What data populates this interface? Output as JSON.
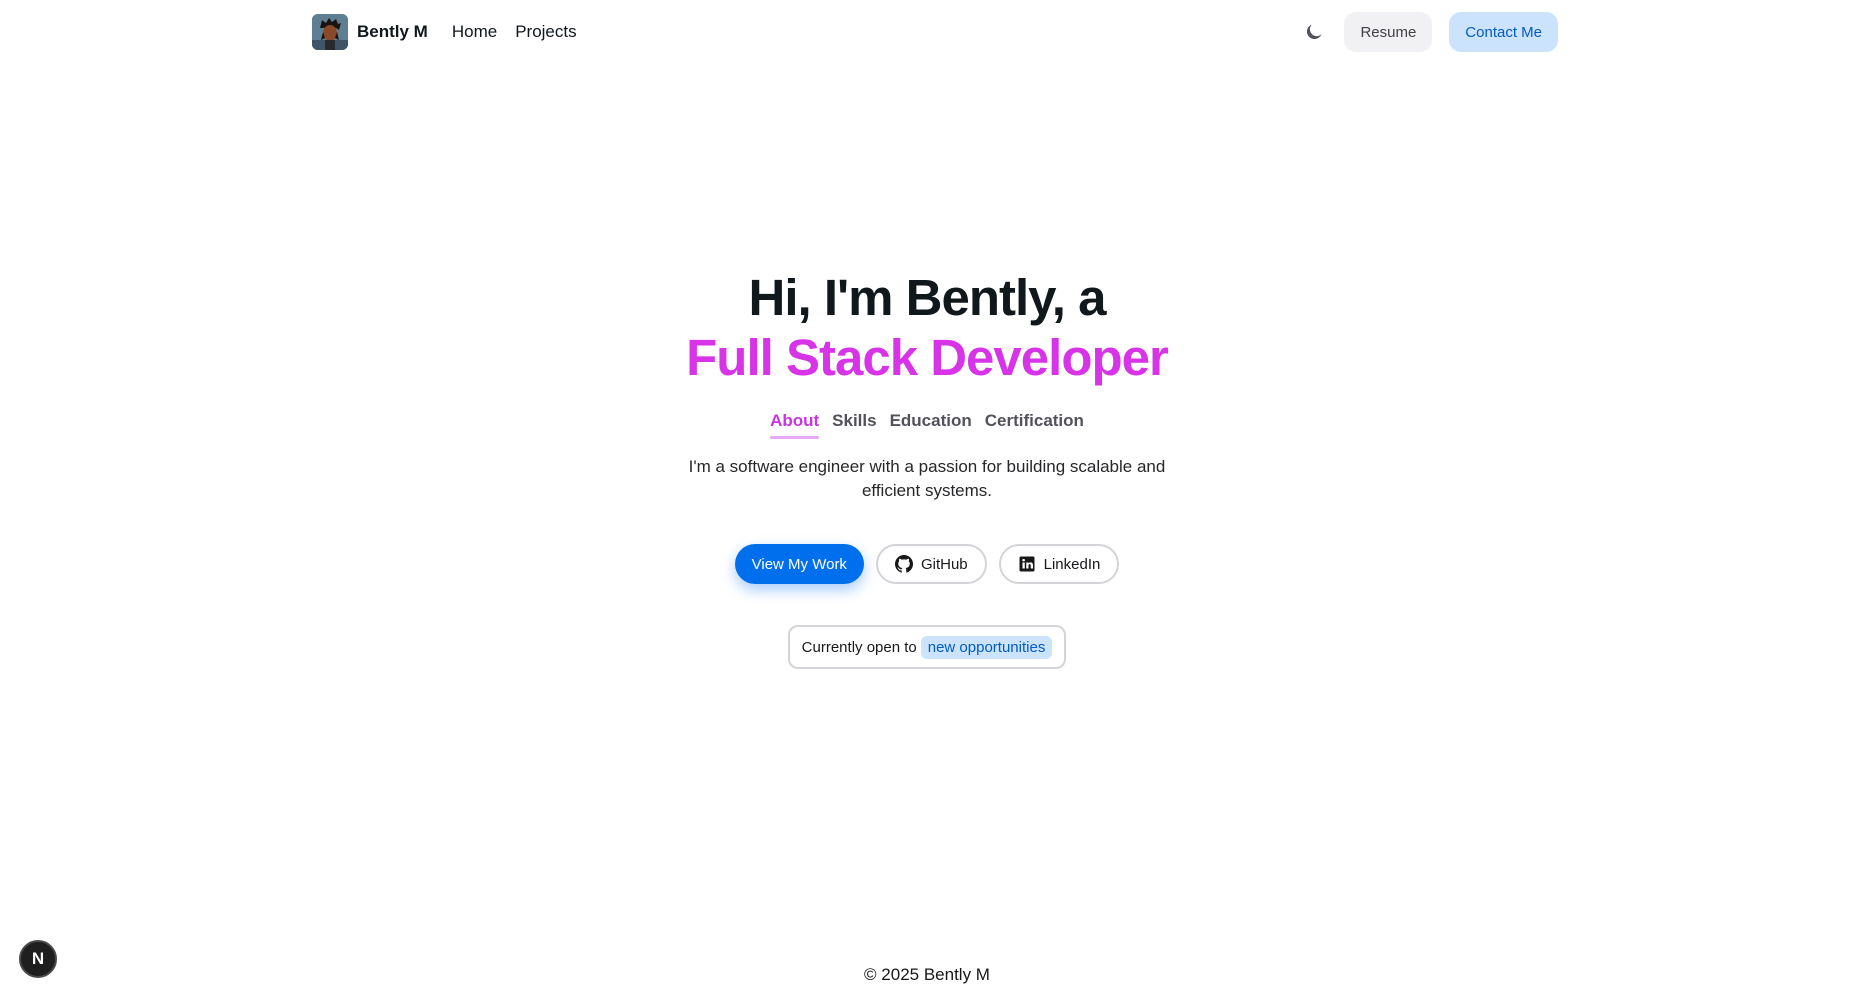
{
  "nav": {
    "brand_name": "Bently M",
    "links": [
      "Home",
      "Projects"
    ],
    "resume_label": "Resume",
    "contact_label": "Contact Me",
    "theme_icon": "moon-icon"
  },
  "hero": {
    "greeting": "Hi, I'm Bently, a",
    "role": "Full Stack Developer",
    "tabs": [
      {
        "label": "About",
        "active": true
      },
      {
        "label": "Skills",
        "active": false
      },
      {
        "label": "Education",
        "active": false
      },
      {
        "label": "Certification",
        "active": false
      }
    ],
    "about_text": "I'm a software engineer with a passion for building scalable and efficient systems.",
    "buttons": {
      "view_work": "View My Work",
      "github": "GitHub",
      "linkedin": "LinkedIn"
    },
    "status": {
      "prefix": "Currently open to",
      "highlight": "new opportunities"
    }
  },
  "footer": {
    "copyright": "© 2025 Bently M"
  },
  "dev_badge": {
    "label": "N"
  },
  "colors": {
    "accent_pink": "#d634e6",
    "primary_blue": "#006fee",
    "soft_blue": "#cce3fd",
    "text_dark": "#11181c"
  }
}
